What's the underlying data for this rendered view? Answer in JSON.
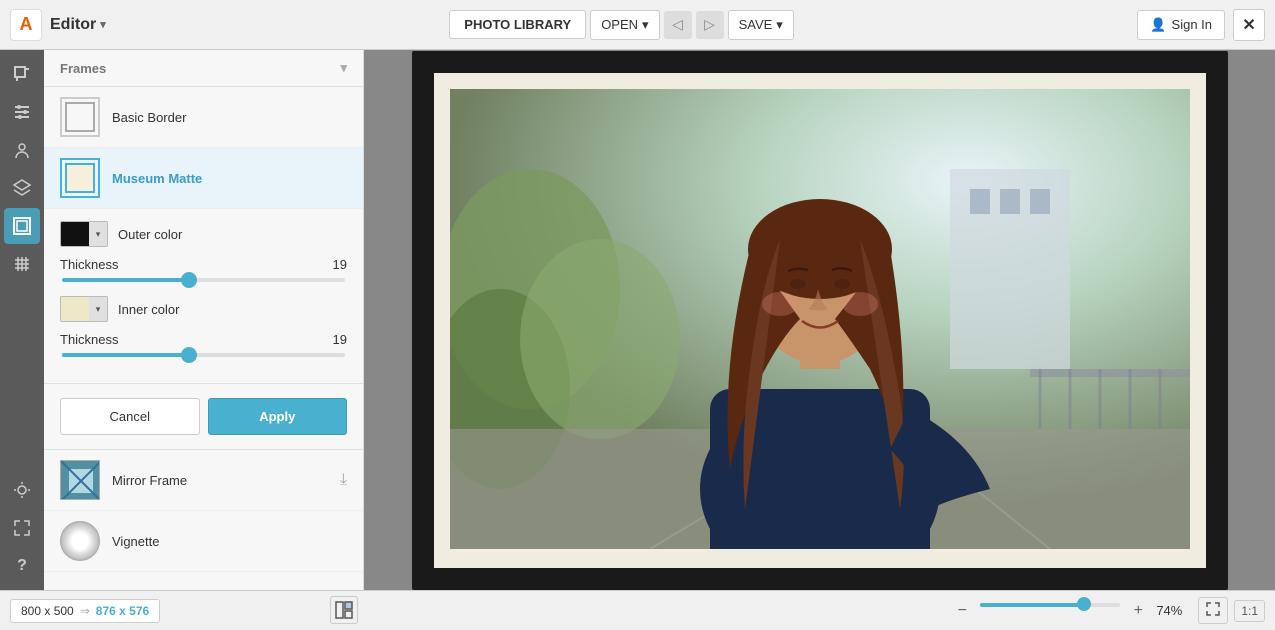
{
  "topbar": {
    "logo": "A",
    "editor_label": "Editor",
    "editor_chevron": "▾",
    "photo_library_label": "PHOTO LIBRARY",
    "open_label": "OPEN",
    "open_chevron": "▾",
    "save_label": "SAVE",
    "save_chevron": "▾",
    "signin_label": "Sign In",
    "close_label": "✕"
  },
  "icon_rail": {
    "icons": [
      {
        "name": "crop-icon",
        "symbol": "⊡",
        "active": false
      },
      {
        "name": "adjust-icon",
        "symbol": "✦",
        "active": false
      },
      {
        "name": "portrait-icon",
        "symbol": "👤",
        "active": false
      },
      {
        "name": "layers-icon",
        "symbol": "⊕",
        "active": false
      },
      {
        "name": "frame-icon",
        "symbol": "▭",
        "active": true
      },
      {
        "name": "texture-icon",
        "symbol": "≋",
        "active": false
      }
    ],
    "bottom_icons": [
      {
        "name": "light-icon",
        "symbol": "☀"
      },
      {
        "name": "expand-icon",
        "symbol": "⤢"
      },
      {
        "name": "help-icon",
        "symbol": "?"
      }
    ]
  },
  "panel": {
    "section_header": "Frames",
    "frames": [
      {
        "id": "basic-border",
        "label": "Basic Border",
        "selected": false
      },
      {
        "id": "museum-matte",
        "label": "Museum Matte",
        "selected": true
      },
      {
        "id": "mirror-frame",
        "label": "Mirror Frame",
        "selected": false
      },
      {
        "id": "vignette",
        "label": "Vignette",
        "selected": false
      }
    ],
    "museum_matte": {
      "outer_color_label": "Outer color",
      "outer_swatch": "#111111",
      "inner_color_label": "Inner color",
      "inner_swatch": "#eeeecc",
      "outer_thickness_label": "Thickness",
      "outer_thickness_value": "19",
      "outer_slider_percent": 45,
      "inner_thickness_label": "Thickness",
      "inner_thickness_value": "19",
      "inner_slider_percent": 45
    },
    "cancel_label": "Cancel",
    "apply_label": "Apply"
  },
  "bottombar": {
    "dim_original": "800 x 500",
    "dim_arrow": "⇒",
    "dim_new": "876 x 576",
    "zoom_minus": "−",
    "zoom_plus": "+",
    "zoom_percent": "74%",
    "zoom_value": 74,
    "fit_label": "⤢",
    "ratio_label": "1:1"
  }
}
